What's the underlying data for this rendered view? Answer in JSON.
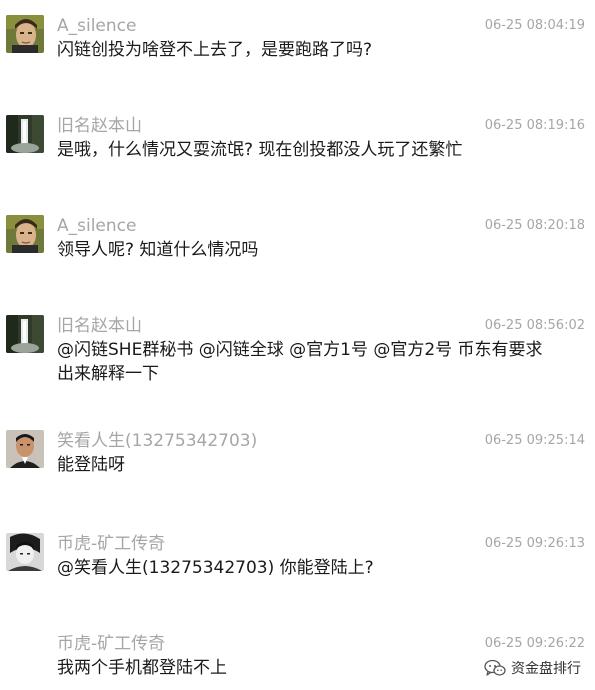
{
  "messages": [
    {
      "avatar": "face-avatar-1",
      "sender": "A_silence",
      "time": "06-25 08:04:19",
      "text": "闪链创投为啥登不上去了，是要跑路了吗?"
    },
    {
      "avatar": "waterfall-avatar",
      "sender": "旧名赵本山",
      "time": "06-25 08:19:16",
      "text": "是哦，什么情况又耍流氓? 现在创投都没人玩了还繁忙"
    },
    {
      "avatar": "face-avatar-1",
      "sender": "A_silence",
      "time": "06-25 08:20:18",
      "text": "领导人呢? 知道什么情况吗"
    },
    {
      "avatar": "waterfall-avatar",
      "sender": "旧名赵本山",
      "time": "06-25 08:56:02",
      "text": "@闪链SHE群秘书 @闪链全球 @官方1号 @官方2号 币东有要求出来解释一下"
    },
    {
      "avatar": "man-portrait-avatar",
      "sender": "笑看人生(13275342703)",
      "time": "06-25 09:25:14",
      "text": "能登陆呀"
    },
    {
      "avatar": "bw-portrait-avatar",
      "sender": "币虎-矿工传奇",
      "time": "06-25 09:26:13",
      "text": "@笑看人生(13275342703) 你能登陆上?"
    },
    {
      "avatar": "",
      "sender": "币虎-矿工传奇",
      "time": "06-25 09:26:22",
      "text": "我两个手机都登陆不上"
    }
  ],
  "watermark": {
    "icon": "wechat-icon",
    "label": "资金盘排行"
  },
  "colors": {
    "meta_text": "#a6a6a6",
    "body_text": "#1a1a1a",
    "background": "#ffffff"
  }
}
